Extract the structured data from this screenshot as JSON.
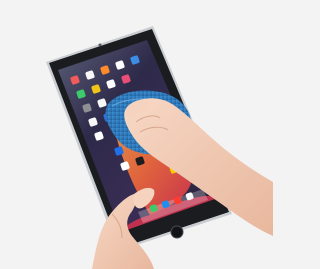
{
  "photo": {
    "subject": "tablet-screen-cleaning-photo",
    "colors": {
      "background": "#f3f3f3",
      "tablet_body": "#c9cdd2",
      "tablet_bezel": "#1b1c1f",
      "screen_dark": "#3a2d55",
      "wallpaper_orange": "#f26a3a",
      "wallpaper_red": "#d8324f",
      "cloth": "#2f7fc3",
      "skin": "#f2c9b1"
    },
    "icons": [
      "app-icon-grid",
      "dock-icon-row",
      "home-button"
    ]
  }
}
